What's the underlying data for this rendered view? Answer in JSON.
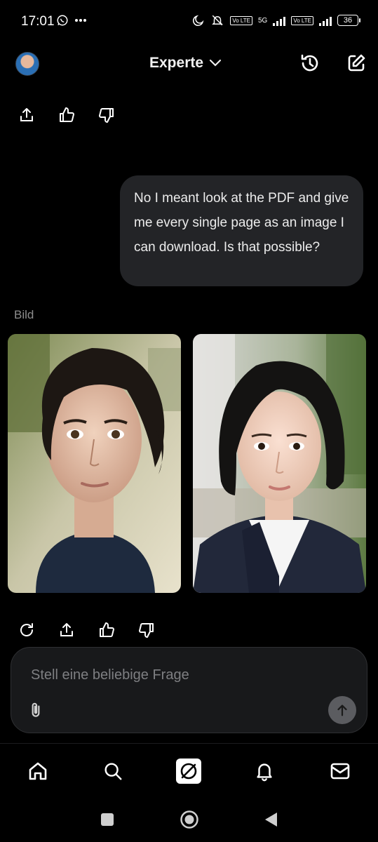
{
  "status_bar": {
    "time": "17:01",
    "battery": "36",
    "network": "5G",
    "volte": "Vo LTE"
  },
  "header": {
    "mode": "Experte",
    "icons": [
      "avatar",
      "history-icon",
      "compose-icon"
    ]
  },
  "conversation": {
    "user_message": "No I meant look at the PDF and give me every single page as an image I can download. Is that possible?",
    "image_caption": "Bild",
    "images": [
      {
        "name": "generated-image-1"
      },
      {
        "name": "generated-image-2"
      }
    ],
    "top_actions": [
      "share-icon",
      "thumbs-up-icon",
      "thumbs-down-icon"
    ],
    "bottom_actions": [
      "regenerate-icon",
      "share-icon",
      "thumbs-up-icon",
      "thumbs-down-icon"
    ]
  },
  "composer": {
    "placeholder": "Stell eine beliebige Frage",
    "value": ""
  },
  "bottom_nav": [
    "home-icon",
    "search-icon",
    "grok-icon",
    "notifications-icon",
    "messages-icon"
  ],
  "system_nav": [
    "recents-icon",
    "home-circle-icon",
    "back-icon"
  ],
  "colors": {
    "background": "#000000",
    "bubble": "#232427",
    "input_bg": "#18191b",
    "send_button": "#5b5c60"
  }
}
